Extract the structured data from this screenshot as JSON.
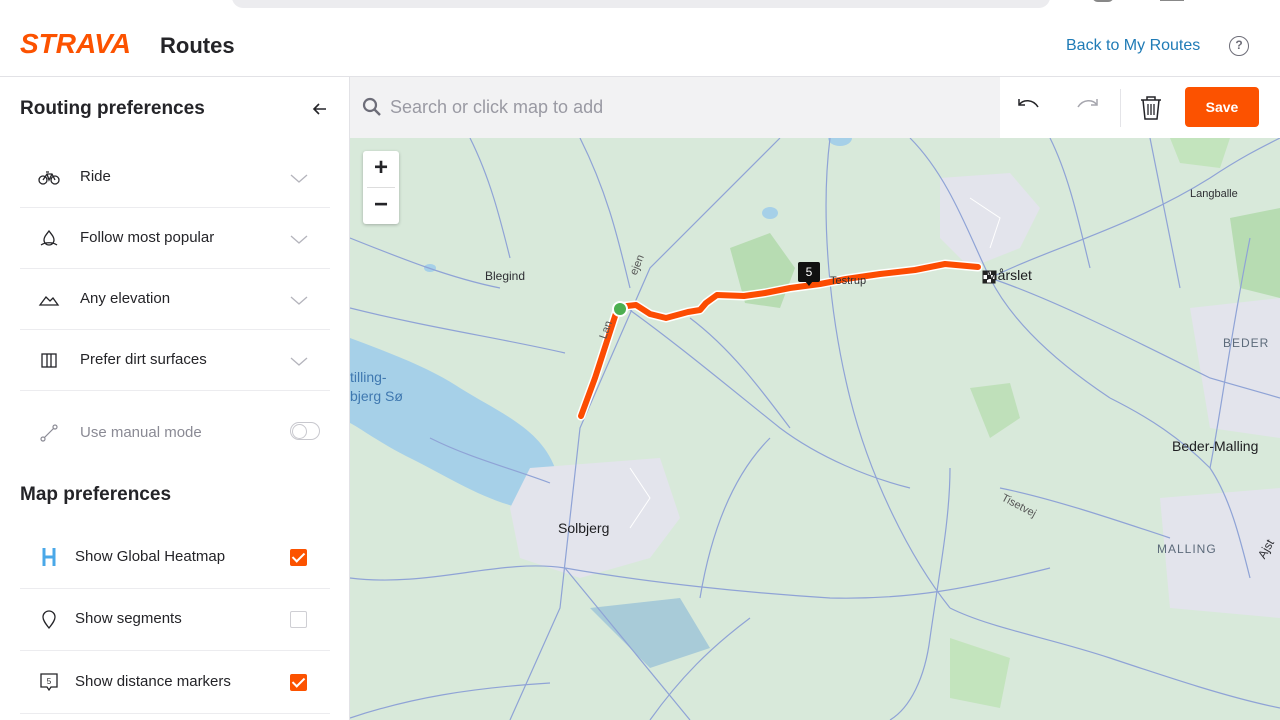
{
  "brand": {
    "logo_text": "STRAVA",
    "color": "#fc5200"
  },
  "header": {
    "title": "Routes",
    "back_link": "Back to My Routes",
    "help_label": "?"
  },
  "sidebar": {
    "routing_title": "Routing preferences",
    "routing_items": [
      {
        "label": "Ride",
        "icon": "bike-icon"
      },
      {
        "label": "Follow most popular",
        "icon": "popularity-icon"
      },
      {
        "label": "Any elevation",
        "icon": "elevation-icon"
      },
      {
        "label": "Prefer dirt surfaces",
        "icon": "surface-icon"
      }
    ],
    "manual_mode": {
      "label": "Use manual mode",
      "enabled": false
    },
    "map_title": "Map preferences",
    "map_items": [
      {
        "label": "Show Global Heatmap",
        "checked": true,
        "icon": "heatmap-icon"
      },
      {
        "label": "Show segments",
        "checked": false,
        "icon": "segment-pin-icon"
      },
      {
        "label": "Show distance markers",
        "checked": true,
        "icon": "distance-marker-icon"
      }
    ]
  },
  "toolbar": {
    "search_placeholder": "Search or click map to add",
    "save_label": "Save"
  },
  "map": {
    "places": {
      "blegind": "Blegind",
      "testrup": "Testrup",
      "marslet": "Mårslet",
      "langballe": "Langballe",
      "beder": "BEDER",
      "beder_malling": "Beder-Malling",
      "stilling_1": "tilling-",
      "stilling_2": "bjerg Sø",
      "solbjerg": "Solbjerg",
      "tisetvej": "Tisetvej",
      "malling": "MALLING",
      "ajst": "Ajst",
      "lan_road": "Lan",
      "vejen_road": "ejen"
    },
    "distance_marker": "5",
    "zoom_in": "+",
    "zoom_out": "−",
    "route_color": "#fc4c02"
  }
}
